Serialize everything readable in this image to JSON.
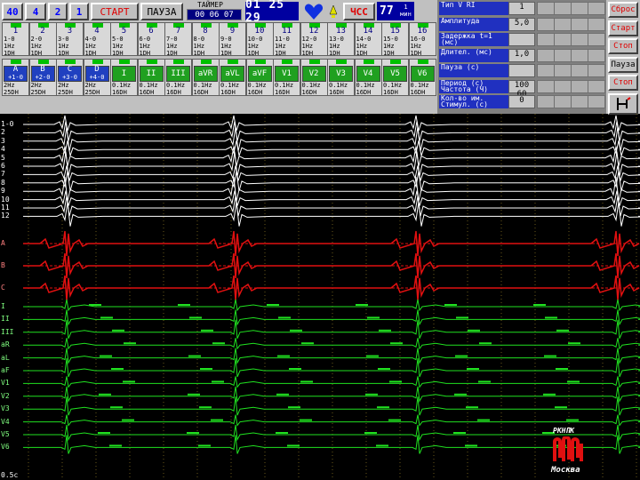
{
  "toolbar": {
    "speed_labels": [
      "40",
      "4",
      "2",
      "1"
    ],
    "start_label": "СТАРТ",
    "pause_label": "ПАУЗА",
    "timer_caption": "ТАЙМЕР",
    "timer_value": "00 06 07",
    "clock": "01 25 29",
    "hss_label": "ЧСС",
    "hss_value": "77",
    "hss_unit": "1 мин"
  },
  "channels_top": [
    {
      "num": "1",
      "l1": "1-0",
      "l2": "1Hz",
      "l3": "1DH"
    },
    {
      "num": "2",
      "l1": "2-0",
      "l2": "1Hz",
      "l3": "1DH"
    },
    {
      "num": "3",
      "l1": "3-0",
      "l2": "1Hz",
      "l3": "1DH"
    },
    {
      "num": "4",
      "l1": "4-0",
      "l2": "1Hz",
      "l3": "1DH"
    },
    {
      "num": "5",
      "l1": "5-0",
      "l2": "1Hz",
      "l3": "1DH"
    },
    {
      "num": "6",
      "l1": "6-0",
      "l2": "1Hz",
      "l3": "1DH"
    },
    {
      "num": "7",
      "l1": "7-0",
      "l2": "1Hz",
      "l3": "1DH"
    },
    {
      "num": "8",
      "l1": "8-0",
      "l2": "1Hz",
      "l3": "1DH"
    },
    {
      "num": "9",
      "l1": "9-0",
      "l2": "1Hz",
      "l3": "1DH"
    },
    {
      "num": "10",
      "l1": "10-0",
      "l2": "1Hz",
      "l3": "1DH"
    },
    {
      "num": "11",
      "l1": "11-0",
      "l2": "1Hz",
      "l3": "1DH"
    },
    {
      "num": "12",
      "l1": "12-0",
      "l2": "1Hz",
      "l3": "1DH"
    },
    {
      "num": "13",
      "l1": "13-0",
      "l2": "1Hz",
      "l3": "1DH"
    },
    {
      "num": "14",
      "l1": "14-0",
      "l2": "1Hz",
      "l3": "1DH"
    },
    {
      "num": "15",
      "l1": "15-0",
      "l2": "1Hz",
      "l3": "1DH"
    },
    {
      "num": "16",
      "l1": "16-0",
      "l2": "1Hz",
      "l3": "1DH"
    }
  ],
  "channels_bottom": [
    {
      "name": "A",
      "sub": "+1-0",
      "l2": "2Hz",
      "l3": "25DH",
      "color": "blue"
    },
    {
      "name": "B",
      "sub": "+2-0",
      "l2": "2Hz",
      "l3": "25DH",
      "color": "blue"
    },
    {
      "name": "C",
      "sub": "+3-0",
      "l2": "2Hz",
      "l3": "25DH",
      "color": "blue"
    },
    {
      "name": "D",
      "sub": "+4-0",
      "l2": "2Hz",
      "l3": "25DH",
      "color": "blue"
    },
    {
      "name": "I",
      "sub": "",
      "l2": "0.1Hz",
      "l3": "16DH",
      "color": "green"
    },
    {
      "name": "II",
      "sub": "",
      "l2": "0.1Hz",
      "l3": "16DH",
      "color": "green"
    },
    {
      "name": "III",
      "sub": "",
      "l2": "0.1Hz",
      "l3": "16DH",
      "color": "green"
    },
    {
      "name": "aVR",
      "sub": "",
      "l2": "0.1Hz",
      "l3": "16DH",
      "color": "green"
    },
    {
      "name": "aVL",
      "sub": "",
      "l2": "0.1Hz",
      "l3": "16DH",
      "color": "green"
    },
    {
      "name": "aVF",
      "sub": "",
      "l2": "0.1Hz",
      "l3": "16DH",
      "color": "green"
    },
    {
      "name": "V1",
      "sub": "",
      "l2": "0.1Hz",
      "l3": "16DH",
      "color": "green"
    },
    {
      "name": "V2",
      "sub": "",
      "l2": "0.1Hz",
      "l3": "16DH",
      "color": "green"
    },
    {
      "name": "V3",
      "sub": "",
      "l2": "0.1Hz",
      "l3": "16DH",
      "color": "green"
    },
    {
      "name": "V4",
      "sub": "",
      "l2": "0.1Hz",
      "l3": "16DH",
      "color": "green"
    },
    {
      "name": "V5",
      "sub": "",
      "l2": "0.1Hz",
      "l3": "16DH",
      "color": "green"
    },
    {
      "name": "V6",
      "sub": "",
      "l2": "0.1Hz",
      "l3": "16DH",
      "color": "green"
    }
  ],
  "params": [
    {
      "label": "Тип V  RI",
      "value": "1"
    },
    {
      "label": "Амплитуда",
      "value": "5,0"
    },
    {
      "label": "Задержка t=1 (мс)",
      "value": ""
    },
    {
      "label": "Длител. (мс)",
      "value": "1,0"
    },
    {
      "label": "Пауза (с)",
      "value": ""
    },
    {
      "label": "Период (с) Частота (Ч)",
      "value": "100 60"
    },
    {
      "label": "Кол-во им. Стимул. (с)",
      "value": "0"
    }
  ],
  "right_buttons": [
    "Сброс",
    "Старт",
    "Стоп",
    "Пауза",
    "Стоп",
    ""
  ],
  "trace_labels": {
    "white": [
      "1-0",
      "2",
      "3",
      "4",
      "5",
      "6",
      "7",
      "8",
      "9",
      "10",
      "11",
      "12"
    ],
    "red": [
      "A",
      "B",
      "C"
    ],
    "green": [
      "I",
      "II",
      "III",
      "aR",
      "aL",
      "aF",
      "V1",
      "V2",
      "V3",
      "V4",
      "V5",
      "V6"
    ]
  },
  "scale_label": "0.5c",
  "logo": {
    "text_top": "РКНПК",
    "text_bottom": "Москва"
  },
  "colors": {
    "white_trace": "#ffffff",
    "red_trace": "#e01010",
    "green_trace": "#20e020",
    "grid": "#6a5a1a"
  }
}
